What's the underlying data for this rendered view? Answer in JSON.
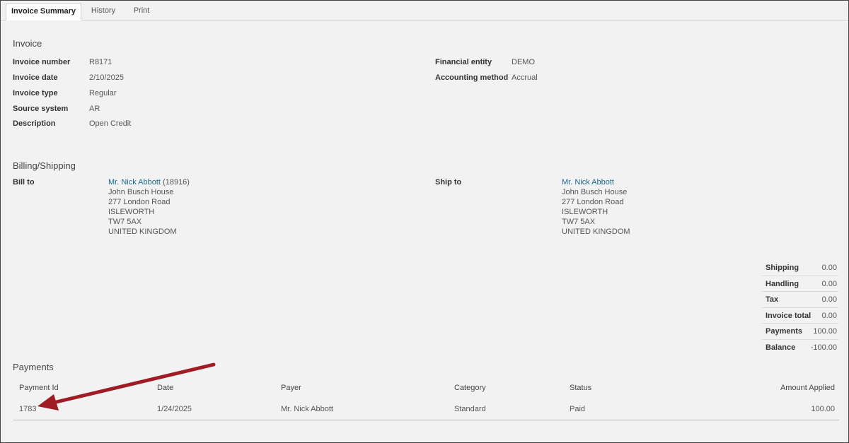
{
  "tabs": [
    {
      "label": "Invoice Summary",
      "active": true
    },
    {
      "label": "History",
      "active": false
    },
    {
      "label": "Print",
      "active": false
    }
  ],
  "invoice": {
    "title": "Invoice",
    "fields_left": [
      {
        "label": "Invoice number",
        "value": "R8171"
      },
      {
        "label": "Invoice date",
        "value": "2/10/2025"
      },
      {
        "label": "Invoice type",
        "value": "Regular"
      },
      {
        "label": "Source system",
        "value": "AR"
      },
      {
        "label": "Description",
        "value": "Open Credit"
      }
    ],
    "fields_right": [
      {
        "label": "Financial entity",
        "value": "DEMO"
      },
      {
        "label": "Accounting method",
        "value": "Accrual"
      }
    ]
  },
  "billing": {
    "title": "Billing/Shipping",
    "bill_to_label": "Bill to",
    "bill_to_name": "Mr. Nick Abbott",
    "bill_to_id": "(18916)",
    "bill_to_lines": [
      "John Busch House",
      "277 London Road",
      "ISLEWORTH",
      "TW7 5AX",
      "UNITED KINGDOM"
    ],
    "ship_to_label": "Ship to",
    "ship_to_name": "Mr. Nick Abbott",
    "ship_to_lines": [
      "John Busch House",
      "277 London Road",
      "ISLEWORTH",
      "TW7 5AX",
      "UNITED KINGDOM"
    ]
  },
  "totals": [
    {
      "label": "Shipping",
      "value": "0.00"
    },
    {
      "label": "Handling",
      "value": "0.00"
    },
    {
      "label": "Tax",
      "value": "0.00"
    },
    {
      "label": "Invoice total",
      "value": "0.00"
    },
    {
      "label": "Payments",
      "value": "100.00"
    },
    {
      "label": "Balance",
      "value": "-100.00"
    }
  ],
  "payments": {
    "title": "Payments",
    "columns": {
      "payment_id": "Payment Id",
      "date": "Date",
      "payer": "Payer",
      "category": "Category",
      "status": "Status",
      "amount": "Amount Applied"
    },
    "rows": [
      {
        "payment_id": "1783",
        "date": "1/24/2025",
        "payer": "Mr. Nick Abbott",
        "category": "Standard",
        "status": "Paid",
        "amount": "100.00"
      }
    ]
  },
  "colors": {
    "link": "#1b6a8f",
    "annotation_arrow": "#a01c24",
    "background": "#f2f2f2"
  }
}
